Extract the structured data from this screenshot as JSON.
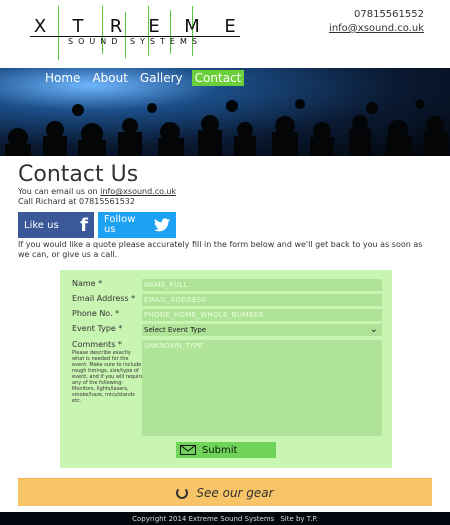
{
  "header": {
    "logo_letters": [
      "X",
      "T",
      "R",
      "E",
      "M",
      "E"
    ],
    "logo_subtitle": "SOUND SYSTEMS",
    "phone": "07815561552",
    "email": "info@xsound.co.uk"
  },
  "nav": {
    "items": [
      {
        "label": "Home",
        "active": false
      },
      {
        "label": "About",
        "active": false
      },
      {
        "label": "Gallery",
        "active": false
      },
      {
        "label": "Contact",
        "active": true
      }
    ]
  },
  "page": {
    "title": "Contact Us",
    "intro_prefix": "You can email us on",
    "intro_email": "info@xsound.co.uk",
    "intro_call": "Call Richard at 07815561532",
    "quote_text": "If you would like a quote please accurately fill in the form below and we'll get back to you as soon as we can, or give us a call."
  },
  "social": {
    "facebook_label": "Like us",
    "twitter_label": "Follow us"
  },
  "form": {
    "name_label": "Name *",
    "name_placeholder": "NAME_FULL",
    "email_label": "Email Address *",
    "email_placeholder": "EMAIL_ADDRESS",
    "phone_label": "Phone No. *",
    "phone_placeholder": "PHONE_HOME_WHOLE_NUMBER",
    "event_label": "Event Type *",
    "event_selected": "Select Event Type",
    "comments_label": "Comments *",
    "comments_placeholder": "UNKNOWN_TYPE",
    "comments_help": "Please describe exactly what is needed for the event. Make sure to include rough timings, size/type of event, and if you will require any of the following: Monitors, lights/lasers, smoke/haze, mics/stands etc.",
    "submit_label": "Submit"
  },
  "gear": {
    "label": "See our gear"
  },
  "footer": {
    "copyright": "Copyright 2014 Extreme Sound Systems",
    "site_by": "Site by T.P."
  },
  "colors": {
    "accent_green": "#6bcf3a",
    "form_bg": "#c9f5b2",
    "field_bg": "#aee398",
    "gear_bg": "#f7c568",
    "facebook": "#3b5998",
    "twitter": "#1da1f2"
  }
}
